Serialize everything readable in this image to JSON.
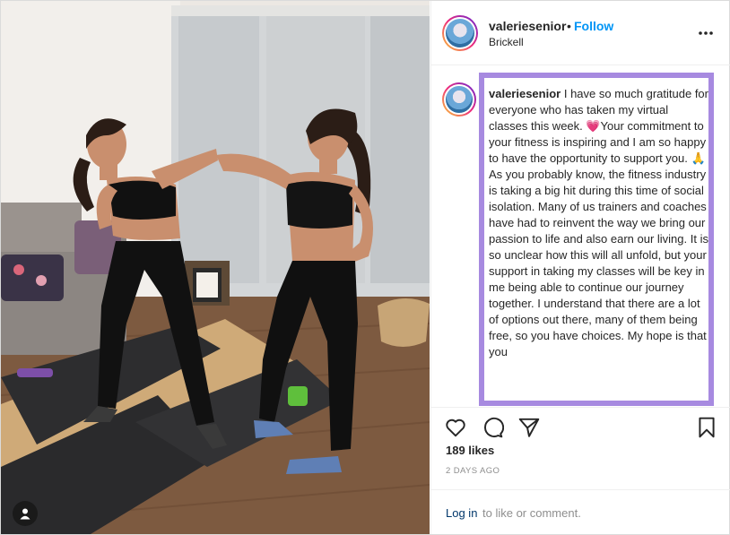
{
  "colors": {
    "follow_blue": "#0095f6",
    "highlight_border": "#a78ae0",
    "login_link": "#00376b",
    "muted_text": "#8e8e8e"
  },
  "photo": {
    "user_tag_icon": "user-silhouette-icon"
  },
  "header": {
    "username": "valeriesenior",
    "separator": "•",
    "follow_label": "Follow",
    "location": "Brickell",
    "more_icon": "more-options-icon"
  },
  "caption": {
    "username": "valeriesenior",
    "text": "I have so much gratitude for everyone who has taken my virtual classes this week. 💗Your commitment to your fitness is inspiring and I am so happy to have the opportunity to support you. 🙏 As you probably know, the fitness industry is taking a big hit during this time of social isolation. Many of us trainers and coaches have had to reinvent the way we bring our passion to life and also earn our living. It is so unclear how this will all unfold, but your support in taking my classes will be key in me being able to continue our journey together. I understand that there are a lot of options out there, many of them being free, so you have choices. My hope is that you"
  },
  "actions": {
    "icons": [
      "heart-icon",
      "comment-icon",
      "share-icon",
      "bookmark-icon"
    ]
  },
  "likes": "189 likes",
  "date": "2 DAYS AGO",
  "login": {
    "link_label": "Log in",
    "rest_text": "to like or comment."
  }
}
